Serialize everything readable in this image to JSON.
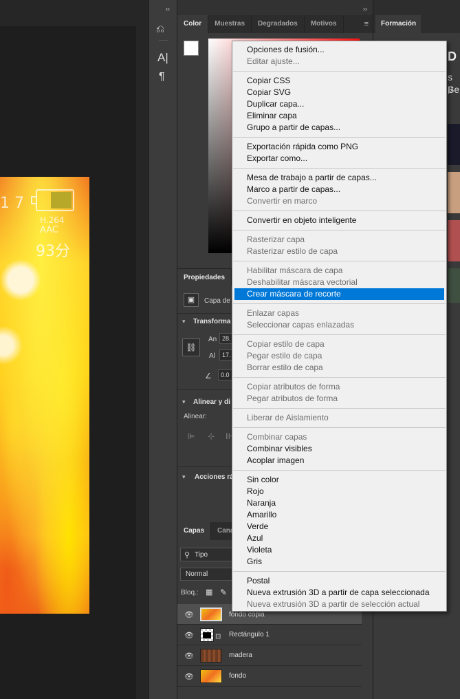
{
  "canvas": {
    "artwork_text": {
      "line1": "1 7",
      "codec": "H.264",
      "audio": "AAC",
      "time": "93分"
    }
  },
  "collapse_left": "‹‹",
  "collapse_right": "››",
  "color_panel": {
    "tabs": [
      "Color",
      "Muestras",
      "Degradados",
      "Motivos"
    ],
    "active_tab": "Color"
  },
  "right_panel": {
    "tab": "Formación",
    "text_top": "D",
    "text_a": "s p",
    "text_b": "Sel"
  },
  "properties": {
    "tabs": [
      "Propiedades"
    ],
    "layer_kind": "Capa de",
    "transform_label": "Transforma",
    "width_label": "An",
    "width_value": "28.",
    "height_label": "Al",
    "height_value": "17.",
    "angle_value": "0.0",
    "align_section": "Alinear y di",
    "align_label": "Alinear:",
    "quick_actions": "Acciones rá"
  },
  "layers": {
    "tabs": [
      "Capas",
      "Canal"
    ],
    "filter_label": "Tipo",
    "blend_mode": "Normal",
    "lock_label": "Bloq.:",
    "items": [
      {
        "name": "fondo copia",
        "selected": true
      },
      {
        "name": "Rectángulo 1",
        "selected": false
      },
      {
        "name": "madera",
        "selected": false
      },
      {
        "name": "fondo",
        "selected": false
      }
    ]
  },
  "context_menu": {
    "groups": [
      [
        {
          "label": "Opciones de fusión...",
          "enabled": true
        },
        {
          "label": "Editar ajuste...",
          "enabled": false
        }
      ],
      [
        {
          "label": "Copiar CSS",
          "enabled": true
        },
        {
          "label": "Copiar SVG",
          "enabled": true
        },
        {
          "label": "Duplicar capa...",
          "enabled": true
        },
        {
          "label": "Eliminar capa",
          "enabled": true
        },
        {
          "label": "Grupo a partir de capas...",
          "enabled": true
        }
      ],
      [
        {
          "label": "Exportación rápida como PNG",
          "enabled": true
        },
        {
          "label": "Exportar como...",
          "enabled": true
        }
      ],
      [
        {
          "label": "Mesa de trabajo a partir de capas...",
          "enabled": true
        },
        {
          "label": "Marco a partir de capas...",
          "enabled": true
        },
        {
          "label": "Convertir en marco",
          "enabled": false
        }
      ],
      [
        {
          "label": "Convertir en objeto inteligente",
          "enabled": true
        }
      ],
      [
        {
          "label": "Rasterizar capa",
          "enabled": false
        },
        {
          "label": "Rasterizar estilo de capa",
          "enabled": false
        }
      ],
      [
        {
          "label": "Habilitar máscara de capa",
          "enabled": false
        },
        {
          "label": "Deshabilitar máscara vectorial",
          "enabled": false
        },
        {
          "label": "Crear máscara de recorte",
          "enabled": true,
          "highlighted": true
        }
      ],
      [
        {
          "label": "Enlazar capas",
          "enabled": false
        },
        {
          "label": "Seleccionar capas enlazadas",
          "enabled": false
        }
      ],
      [
        {
          "label": "Copiar estilo de capa",
          "enabled": false
        },
        {
          "label": "Pegar estilo de capa",
          "enabled": false
        },
        {
          "label": "Borrar estilo de capa",
          "enabled": false
        }
      ],
      [
        {
          "label": "Copiar atributos de forma",
          "enabled": false
        },
        {
          "label": "Pegar atributos de forma",
          "enabled": false
        }
      ],
      [
        {
          "label": "Liberar de Aislamiento",
          "enabled": false
        }
      ],
      [
        {
          "label": "Combinar capas",
          "enabled": false
        },
        {
          "label": "Combinar visibles",
          "enabled": true
        },
        {
          "label": "Acoplar imagen",
          "enabled": true
        }
      ],
      [
        {
          "label": "Sin color",
          "enabled": true
        },
        {
          "label": "Rojo",
          "enabled": true
        },
        {
          "label": "Naranja",
          "enabled": true
        },
        {
          "label": "Amarillo",
          "enabled": true
        },
        {
          "label": "Verde",
          "enabled": true
        },
        {
          "label": "Azul",
          "enabled": true
        },
        {
          "label": "Violeta",
          "enabled": true
        },
        {
          "label": "Gris",
          "enabled": true
        }
      ],
      [
        {
          "label": "Postal",
          "enabled": true
        },
        {
          "label": "Nueva extrusión 3D a partir de capa seleccionada",
          "enabled": true
        },
        {
          "label": "Nueva extrusión 3D a partir de selección actual",
          "enabled": false
        }
      ]
    ]
  },
  "colors": {
    "highlight": "#0078d7",
    "menu_bg": "#f0f0f0",
    "panel_bg": "#3a3a3a"
  }
}
